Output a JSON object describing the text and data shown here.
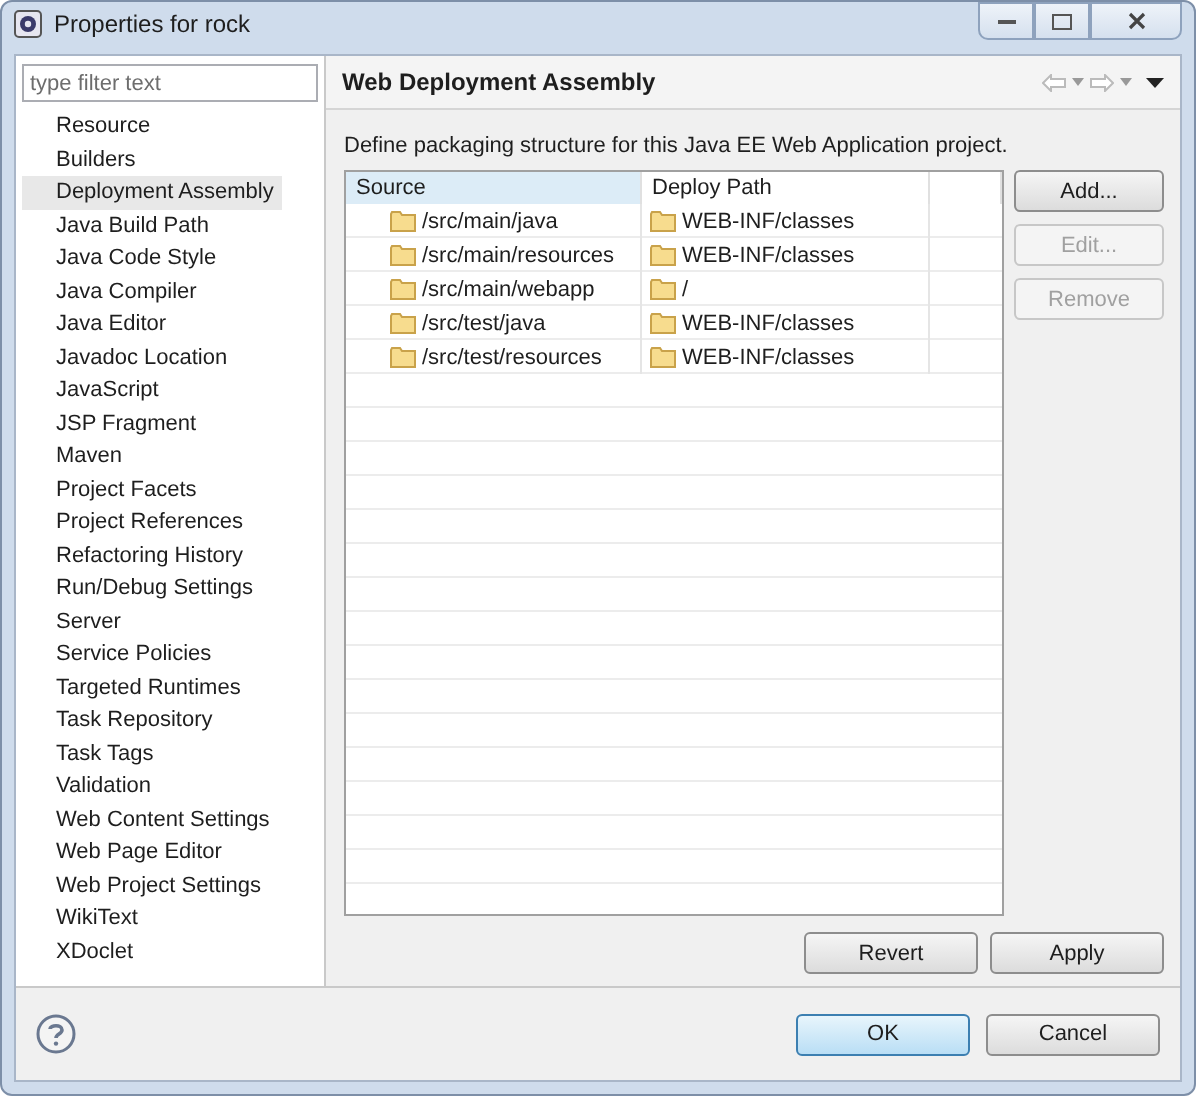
{
  "window": {
    "title": "Properties for rock"
  },
  "filter": {
    "placeholder": "type filter text"
  },
  "sidebar": {
    "items": [
      {
        "label": "Resource",
        "selected": false
      },
      {
        "label": "Builders",
        "selected": false
      },
      {
        "label": "Deployment Assembly",
        "selected": true
      },
      {
        "label": "Java Build Path",
        "selected": false
      },
      {
        "label": "Java Code Style",
        "selected": false
      },
      {
        "label": "Java Compiler",
        "selected": false
      },
      {
        "label": "Java Editor",
        "selected": false
      },
      {
        "label": "Javadoc Location",
        "selected": false
      },
      {
        "label": "JavaScript",
        "selected": false
      },
      {
        "label": "JSP Fragment",
        "selected": false
      },
      {
        "label": "Maven",
        "selected": false
      },
      {
        "label": "Project Facets",
        "selected": false
      },
      {
        "label": "Project References",
        "selected": false
      },
      {
        "label": "Refactoring History",
        "selected": false
      },
      {
        "label": "Run/Debug Settings",
        "selected": false
      },
      {
        "label": "Server",
        "selected": false
      },
      {
        "label": "Service Policies",
        "selected": false
      },
      {
        "label": "Targeted Runtimes",
        "selected": false
      },
      {
        "label": "Task Repository",
        "selected": false
      },
      {
        "label": "Task Tags",
        "selected": false
      },
      {
        "label": "Validation",
        "selected": false
      },
      {
        "label": "Web Content Settings",
        "selected": false
      },
      {
        "label": "Web Page Editor",
        "selected": false
      },
      {
        "label": "Web Project Settings",
        "selected": false
      },
      {
        "label": "WikiText",
        "selected": false
      },
      {
        "label": "XDoclet",
        "selected": false
      }
    ]
  },
  "page": {
    "title": "Web Deployment Assembly",
    "description": "Define packaging structure for this Java EE Web Application project."
  },
  "table": {
    "columns": [
      "Source",
      "Deploy Path"
    ],
    "rows": [
      {
        "source": "/src/main/java",
        "deploy_path": "WEB-INF/classes"
      },
      {
        "source": "/src/main/resources",
        "deploy_path": "WEB-INF/classes"
      },
      {
        "source": "/src/main/webapp",
        "deploy_path": "/"
      },
      {
        "source": "/src/test/java",
        "deploy_path": "WEB-INF/classes"
      },
      {
        "source": "/src/test/resources",
        "deploy_path": "WEB-INF/classes"
      }
    ]
  },
  "side_buttons": [
    {
      "label": "Add...",
      "disabled": false
    },
    {
      "label": "Edit...",
      "disabled": true
    },
    {
      "label": "Remove",
      "disabled": true
    }
  ],
  "page_buttons": [
    "Revert",
    "Apply"
  ],
  "dialog_buttons": [
    {
      "label": "OK",
      "default": true
    },
    {
      "label": "Cancel",
      "default": false
    }
  ]
}
